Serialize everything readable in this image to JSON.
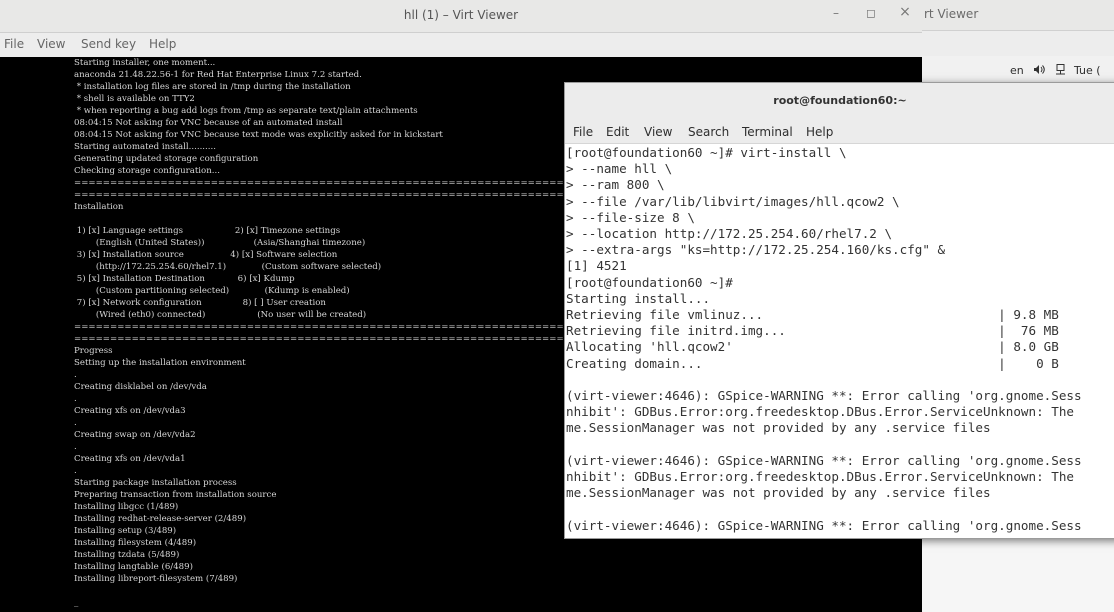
{
  "background_window": {
    "title_fragment": "rt Viewer",
    "topbar": {
      "language": "en",
      "volume_icon": "speaker-icon",
      "network_icon": "network-icon",
      "clock_fragment": "Tue ("
    }
  },
  "virt_viewer": {
    "title": "hll (1) – Virt Viewer",
    "controls": {
      "minimize": "–",
      "maximize": "◻",
      "close": "×"
    },
    "menu": [
      "File",
      "View",
      "Send key",
      "Help"
    ],
    "console_lines": [
      "Starting installer, one moment...",
      "anaconda 21.48.22.56-1 for Red Hat Enterprise Linux 7.2 started.",
      " * installation log files are stored in /tmp during the installation",
      " * shell is available on TTY2",
      " * when reporting a bug add logs from /tmp as separate text/plain attachments",
      "08:04:15 Not asking for VNC because of an automated install",
      "08:04:15 Not asking for VNC because text mode was explicitly asked for in kickstart",
      "Starting automated install..........",
      "Generating updated storage configuration",
      "Checking storage configuration...",
      "================================================================================",
      "================================================================================",
      "Installation",
      "",
      " 1) [x] Language settings                   2) [x] Timezone settings",
      "        (English (United States))                  (Asia/Shanghai timezone)",
      " 3) [x] Installation source                 4) [x] Software selection",
      "        (http://172.25.254.60/rhel7.1)             (Custom software selected)",
      " 5) [x] Installation Destination            6) [x] Kdump",
      "        (Custom partitioning selected)             (Kdump is enabled)",
      " 7) [x] Network configuration               8) [ ] User creation",
      "        (Wired (eth0) connected)                   (No user will be created)",
      "================================================================================",
      "================================================================================",
      "Progress",
      "Setting up the installation environment",
      ".",
      "Creating disklabel on /dev/vda",
      ".",
      "Creating xfs on /dev/vda3",
      ".",
      "Creating swap on /dev/vda2",
      ".",
      "Creating xfs on /dev/vda1",
      ".",
      "Starting package installation process",
      "Preparing transaction from installation source",
      "Installing libgcc (1/489)",
      "Installing redhat-release-server (2/489)",
      "Installing setup (3/489)",
      "Installing filesystem (4/489)",
      "Installing tzdata (5/489)",
      "Installing langtable (6/489)",
      "Installing libreport-filesystem (7/489)",
      "",
      "_"
    ]
  },
  "terminal": {
    "title": "root@foundation60:~",
    "menu": [
      "File",
      "Edit",
      "View",
      "Search",
      "Terminal",
      "Help"
    ],
    "lines": [
      "[root@foundation60 ~]# virt-install \\",
      "> --name hll \\",
      "> --ram 800 \\",
      "> --file /var/lib/libvirt/images/hll.qcow2 \\",
      "> --file-size 8 \\",
      "> --location http://172.25.254.60/rhel7.2 \\",
      "> --extra-args \"ks=http://172.25.254.160/ks.cfg\" &",
      "[1] 4521",
      "[root@foundation60 ~]#",
      "Starting install...",
      "Retrieving file vmlinuz...                               | 9.8 MB",
      "Retrieving file initrd.img...                            |  76 MB",
      "Allocating 'hll.qcow2'                                   | 8.0 GB",
      "Creating domain...                                       |    0 B",
      "",
      "(virt-viewer:4646): GSpice-WARNING **: Error calling 'org.gnome.Sess",
      "nhibit': GDBus.Error:org.freedesktop.DBus.Error.ServiceUnknown: The",
      "me.SessionManager was not provided by any .service files",
      "",
      "(virt-viewer:4646): GSpice-WARNING **: Error calling 'org.gnome.Sess",
      "nhibit': GDBus.Error:org.freedesktop.DBus.Error.ServiceUnknown: The",
      "me.SessionManager was not provided by any .service files",
      "",
      "(virt-viewer:4646): GSpice-WARNING **: Error calling 'org.gnome.Sess"
    ]
  }
}
